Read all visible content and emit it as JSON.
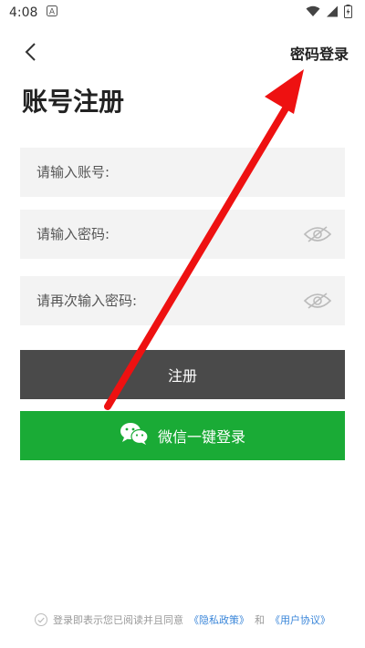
{
  "status_bar": {
    "time": "4:08"
  },
  "header": {
    "password_login": "密码登录"
  },
  "page": {
    "title": "账号注册"
  },
  "form": {
    "account_placeholder": "请输入账号:",
    "password_placeholder": "请输入密码:",
    "confirm_placeholder": "请再次输入密码:"
  },
  "buttons": {
    "register": "注册",
    "wechat_login": "微信一键登录"
  },
  "agreement": {
    "prefix": "登录即表示您已阅读并且同意",
    "privacy": "《隐私政策》",
    "and": "和",
    "user_agreement": "《用户协议》"
  },
  "colors": {
    "accent_green": "#1aab36",
    "register_gray": "#4a4a4a",
    "arrow_red": "#ee1111",
    "link_blue": "#3a86d9"
  }
}
